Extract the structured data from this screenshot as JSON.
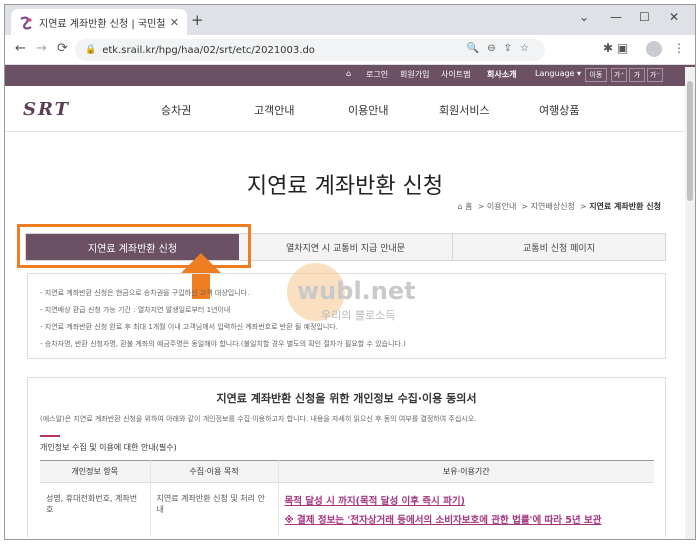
{
  "browser": {
    "tab_title": "지연료 계좌반환 신청 | 국민철도",
    "tab_close": "✕",
    "new_tab": "+",
    "url": "etk.srail.kr/hpg/haa/02/srt/etc/2021003.do",
    "window": {
      "minimize": "⌄",
      "restore": "—",
      "maximize": "☐",
      "close": "✕"
    }
  },
  "util_bar": {
    "items": [
      "로그인",
      "회원가입",
      "사이트맵",
      "회사소개"
    ],
    "language": "Language",
    "buttons": [
      "이동",
      "가⁺",
      "가",
      "가⁻"
    ]
  },
  "gnb": {
    "logo": "SRT",
    "menu": [
      "승차권",
      "고객안내",
      "이용안내",
      "회원서비스",
      "여행상품"
    ]
  },
  "page": {
    "title": "지연료 계좌반환 신청",
    "breadcrumb": [
      "홈",
      "이용안내",
      "지연배상신청",
      "지연료 계좌반환 신청"
    ]
  },
  "subtabs": [
    "지연료 계좌반환 신청",
    "열차지연 시 교통비 지급 안내문",
    "교통비 신청 페이지"
  ],
  "notice": [
    "- 지연료 계좌반환 신청은 현금으로 승차권을 구입하신 고객 대상입니다.",
    "- 지연배상 환급 신청 가능 기간 : 열차지연 발생일로부터 1년이내",
    "- 지연료 계좌반환 신청 완료 후 최대 1개월 이내 고객님께서 입력하신 계좌번호로 반환 될 예정입니다.",
    "- 승차자명, 반환 신청자명, 환불 계좌의 예금주명은 동일해야 합니다.(불일치할 경우 별도의 확인 절차가 필요할 수 있습니다.)"
  ],
  "watermark": {
    "brand": "wubl.net",
    "sub": "우리의 불로소득"
  },
  "consent": {
    "title": "지연료 계좌반환 신청을 위한 개인정보 수집·이용 동의서",
    "desc": "(에스알)은 지연료 계좌반환 신청을 위하여 아래와 같이 개인정보를 수집·이용하고자 합니다. 내용을 자세히 읽으신 후 동의 여부를 결정하여 주십시오.",
    "section": "개인정보 수집 및 이용에 대한 안내(필수)",
    "headers": [
      "개인정보 항목",
      "수집·이용 목적",
      "보유·이용기간"
    ],
    "row": {
      "items": "성명, 휴대전화번호, 계좌번호",
      "purpose": "지연료 계좌반환 신청 및 처리 안내",
      "retention_1": "목적 달성 시 까지(목적 달성 이후 즉시 파기)",
      "retention_2": "※ 결제 정보는 '전자상거래 등에서의 소비자보호에 관한 법률'에 따라 5년 보관"
    }
  },
  "colors": {
    "brand": "#6c5165",
    "highlight": "#ef7d22",
    "emphasis": "#a43580"
  }
}
